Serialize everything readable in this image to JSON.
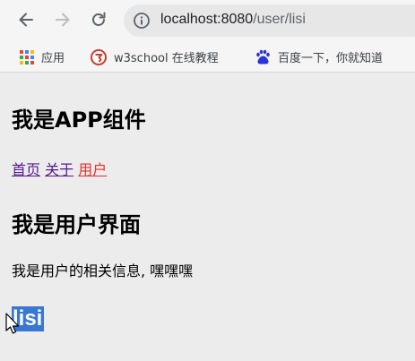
{
  "browser": {
    "url_host": "localhost:8080",
    "url_path": "/user/lisi",
    "bookmarks": [
      {
        "label": "应用",
        "icon": "apps-grid-icon"
      },
      {
        "label": "w3school 在线教程",
        "icon": "w3school-logo-icon"
      },
      {
        "label": "百度一下，你就知道",
        "icon": "baidu-paw-icon"
      }
    ]
  },
  "app": {
    "title": "我是APP组件",
    "nav": [
      {
        "label": "首页",
        "active": false
      },
      {
        "label": "关于",
        "active": false
      },
      {
        "label": "用户",
        "active": true
      }
    ],
    "user": {
      "heading": "我是用户界面",
      "info": "我是用户的相关信息, 嘿嘿嘿",
      "username": "lisi"
    }
  },
  "colors": {
    "link": "#551a8b",
    "active_link": "#e0312b",
    "selection": "#3a76d4"
  }
}
